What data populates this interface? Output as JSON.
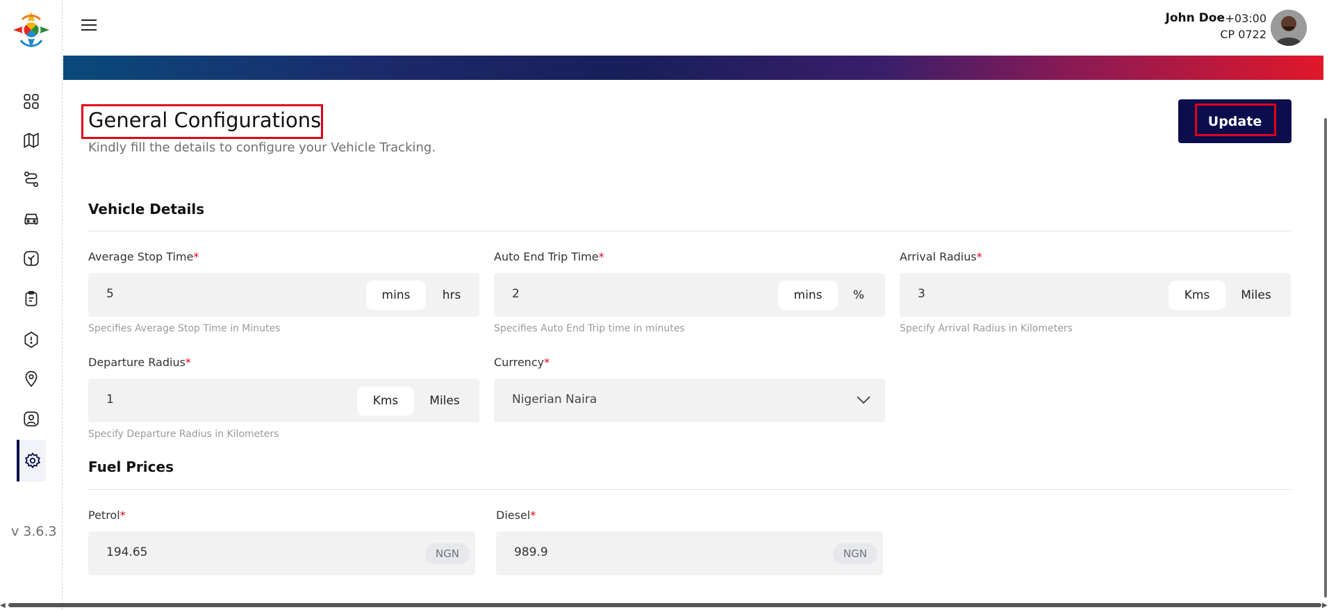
{
  "app": {
    "version": "v 3.6.3"
  },
  "user": {
    "name": "John Doe",
    "timezone": "+03:00",
    "code": "CP 0722"
  },
  "page": {
    "title": "General Configurations",
    "subtitle": "Kindly fill the details to configure your Vehicle Tracking.",
    "update_label": "Update"
  },
  "vehicle_details": {
    "title": "Vehicle Details",
    "average_stop_time": {
      "label": "Average Stop Time",
      "required": "*",
      "value": "5",
      "units": [
        "mins",
        "hrs"
      ],
      "selected_unit": "mins",
      "hint": "Specifies Average Stop Time in Minutes"
    },
    "auto_end_trip_time": {
      "label": "Auto End Trip Time",
      "required": "*",
      "value": "2",
      "units": [
        "mins",
        "%"
      ],
      "selected_unit": "mins",
      "hint": "Specifies Auto End Trip time in minutes"
    },
    "arrival_radius": {
      "label": "Arrival Radius",
      "required": "*",
      "value": "3",
      "units": [
        "Kms",
        "Miles"
      ],
      "selected_unit": "Kms",
      "hint": "Specify Arrival Radius in Kilometers"
    },
    "departure_radius": {
      "label": "Departure Radius",
      "required": "*",
      "value": "1",
      "units": [
        "Kms",
        "Miles"
      ],
      "selected_unit": "Kms",
      "hint": "Specify Departure Radius in Kilometers"
    },
    "currency": {
      "label": "Currency",
      "required": "*",
      "value": "Nigerian Naira"
    }
  },
  "fuel_prices": {
    "title": "Fuel Prices",
    "petrol": {
      "label": "Petrol",
      "required": "*",
      "value": "194.65",
      "currency": "NGN"
    },
    "diesel": {
      "label": "Diesel",
      "required": "*",
      "value": "989.9",
      "currency": "NGN"
    }
  },
  "sidebar": {
    "items": [
      {
        "icon": "dashboard-grid-icon"
      },
      {
        "icon": "map-icon"
      },
      {
        "icon": "route-icon"
      },
      {
        "icon": "car-icon"
      },
      {
        "icon": "tree-icon"
      },
      {
        "icon": "clipboard-icon"
      },
      {
        "icon": "alert-shield-icon"
      },
      {
        "icon": "location-pin-icon"
      },
      {
        "icon": "user-profile-icon"
      },
      {
        "icon": "gear-icon",
        "active": true
      }
    ]
  },
  "colors": {
    "primary": "#0b0d4d",
    "highlight": "#e0001a",
    "field_bg": "#f2f2f2"
  }
}
